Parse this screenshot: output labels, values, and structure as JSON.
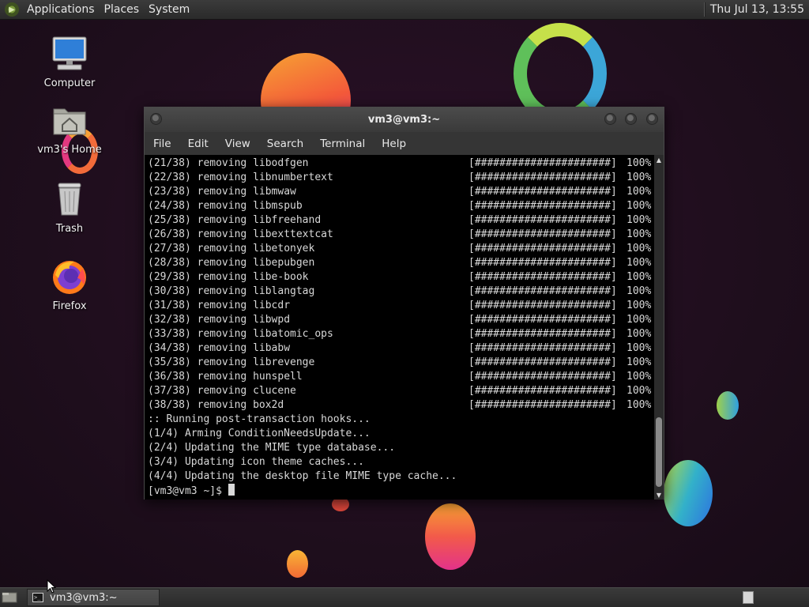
{
  "top_panel": {
    "menus": [
      "Applications",
      "Places",
      "System"
    ],
    "clock": "Thu Jul 13, 13:55"
  },
  "desktop_icons": [
    {
      "label": "Computer",
      "icon": "computer-icon"
    },
    {
      "label": "vm3's Home",
      "icon": "home-folder-icon"
    },
    {
      "label": "Trash",
      "icon": "trash-icon"
    },
    {
      "label": "Firefox",
      "icon": "firefox-icon"
    }
  ],
  "terminal": {
    "title": "vm3@vm3:~",
    "menu": [
      "File",
      "Edit",
      "View",
      "Search",
      "Terminal",
      "Help"
    ],
    "progress_bar": "[######################]",
    "removals": [
      {
        "step": "(21/38)",
        "text": "removing libodfgen",
        "percent": "100%"
      },
      {
        "step": "(22/38)",
        "text": "removing libnumbertext",
        "percent": "100%"
      },
      {
        "step": "(23/38)",
        "text": "removing libmwaw",
        "percent": "100%"
      },
      {
        "step": "(24/38)",
        "text": "removing libmspub",
        "percent": "100%"
      },
      {
        "step": "(25/38)",
        "text": "removing libfreehand",
        "percent": "100%"
      },
      {
        "step": "(26/38)",
        "text": "removing libexttextcat",
        "percent": "100%"
      },
      {
        "step": "(27/38)",
        "text": "removing libetonyek",
        "percent": "100%"
      },
      {
        "step": "(28/38)",
        "text": "removing libepubgen",
        "percent": "100%"
      },
      {
        "step": "(29/38)",
        "text": "removing libe-book",
        "percent": "100%"
      },
      {
        "step": "(30/38)",
        "text": "removing liblangtag",
        "percent": "100%"
      },
      {
        "step": "(31/38)",
        "text": "removing libcdr",
        "percent": "100%"
      },
      {
        "step": "(32/38)",
        "text": "removing libwpd",
        "percent": "100%"
      },
      {
        "step": "(33/38)",
        "text": "removing libatomic_ops",
        "percent": "100%"
      },
      {
        "step": "(34/38)",
        "text": "removing libabw",
        "percent": "100%"
      },
      {
        "step": "(35/38)",
        "text": "removing librevenge",
        "percent": "100%"
      },
      {
        "step": "(36/38)",
        "text": "removing hunspell",
        "percent": "100%"
      },
      {
        "step": "(37/38)",
        "text": "removing clucene",
        "percent": "100%"
      },
      {
        "step": "(38/38)",
        "text": "removing box2d",
        "percent": "100%"
      }
    ],
    "hooks": [
      ":: Running post-transaction hooks...",
      "(1/4) Arming ConditionNeedsUpdate...",
      "(2/4) Updating the MIME type database...",
      "(3/4) Updating icon theme caches...",
      "(4/4) Updating the desktop file MIME type cache..."
    ],
    "prompt": "[vm3@vm3 ~]$"
  },
  "bottom_panel": {
    "task_label": "vm3@vm3:~"
  },
  "colors": {
    "panel": "#2f2f2f",
    "terminal_bg": "#000000",
    "terminal_fg": "#d8d8d8",
    "desktop_bg": "#22101f"
  }
}
